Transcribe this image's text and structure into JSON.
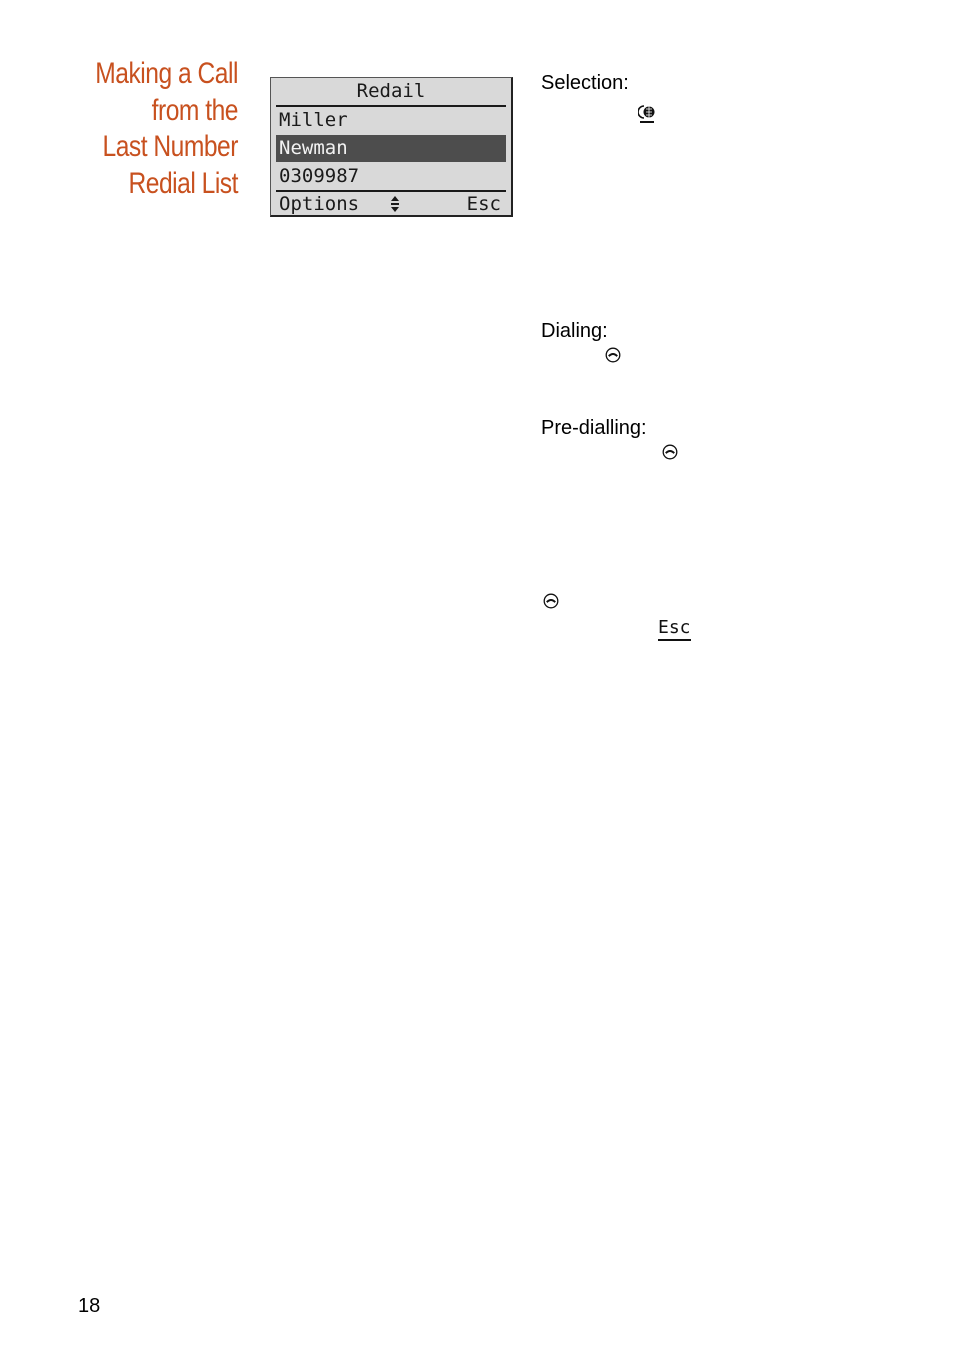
{
  "section_title": {
    "lines": [
      "Making a Call",
      "from the",
      "Last Number",
      "Redial List"
    ],
    "color": "#c8511f"
  },
  "lcd": {
    "title": "Redail",
    "entries": [
      {
        "label": "Miller",
        "selected": false
      },
      {
        "label": "Newman",
        "selected": true
      },
      {
        "label": "0309987",
        "selected": false
      }
    ],
    "softkey_left": "Options",
    "nav_icon": "up-down-arrows-icon",
    "softkey_right": "Esc",
    "background_color": "#d9d9d9",
    "highlight_color": "#4d4d4d"
  },
  "steps": [
    {
      "heading": "Selection:",
      "icon": "redial-key-icon"
    },
    {
      "heading": "Dialing:",
      "icon": "handset-key-icon"
    },
    {
      "heading": "Pre-dialling:",
      "icon": "handset-key-icon"
    }
  ],
  "extra_icons": {
    "end_call": "handset-key-icon",
    "esc_softkey_label": "Esc"
  },
  "page_number": "18"
}
